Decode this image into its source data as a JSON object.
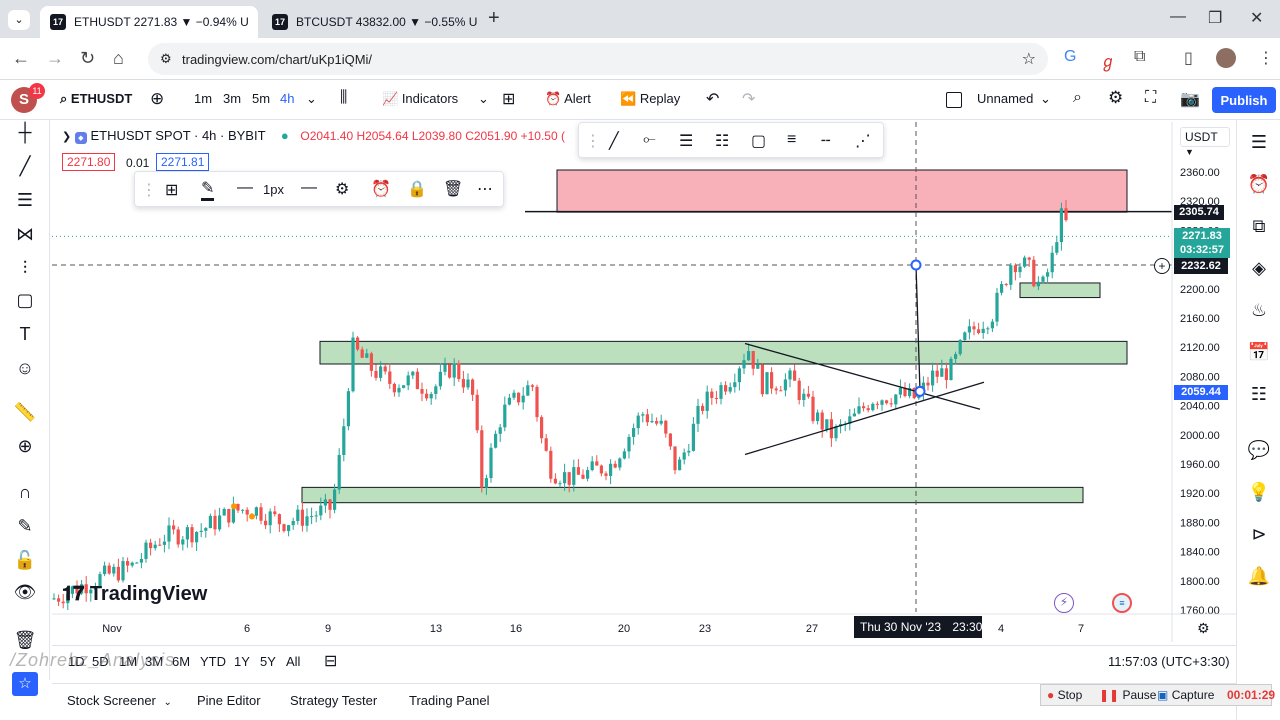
{
  "browser": {
    "tabs": [
      {
        "title": "ETHUSDT 2271.83 ▼ −0.94% U",
        "active": true
      },
      {
        "title": "BTCUSDT 43832.00 ▼ −0.55% U",
        "active": false
      }
    ],
    "new_tab": "+",
    "url": "tradingview.com/chart/uKp1iQMi/"
  },
  "toolbar": {
    "avatar_letter": "S",
    "notifications": "11",
    "symbol": "ETHUSDT",
    "intervals": [
      "1m",
      "3m",
      "5m",
      "4h"
    ],
    "indicators": "Indicators",
    "alert": "Alert",
    "replay": "Replay",
    "layout_name": "Unnamed",
    "publish": "Publish"
  },
  "chart": {
    "title": "ETHUSDT SPOT · 4h · BYBIT",
    "ohlc": "O2041.40 H2054.64 L2039.80 C2051.90 +10.50 (",
    "bid": "2271.80",
    "spread": "0.01",
    "ask": "2271.81",
    "currency": "USDT",
    "watermark": "TradingView",
    "price_ticks": [
      "2360.00",
      "2320.00",
      "2280.00",
      "2240.00",
      "2200.00",
      "2160.00",
      "2120.00",
      "2080.00",
      "2040.00",
      "2000.00",
      "1960.00",
      "1920.00",
      "1880.00",
      "1840.00",
      "1800.00",
      "1760.00"
    ],
    "price_labels": {
      "resistance": "2305.74",
      "last": "2271.83",
      "countdown": "03:32:57",
      "crosshair": "2232.62",
      "blue": "2059.44"
    },
    "time_ticks": [
      "Nov",
      "6",
      "9",
      "13",
      "16",
      "20",
      "23",
      "27",
      "4",
      "7"
    ],
    "crosshair_time": "Thu 30 Nov '23",
    "crosshair_clock": "23:30",
    "drawing_toolbar": {
      "width_label": "1px"
    }
  },
  "bottom": {
    "ranges": [
      "1D",
      "5D",
      "1M",
      "3M",
      "6M",
      "YTD",
      "1Y",
      "5Y",
      "All"
    ],
    "clock": "11:57:03 (UTC+3:30)",
    "channel_watermark": "/Zohrehz_Analysis"
  },
  "panels": [
    "Stock Screener",
    "Pine Editor",
    "Strategy Tester",
    "Trading Panel"
  ],
  "recorder": {
    "stop": "Stop",
    "pause": "Pause",
    "capture": "Capture",
    "elapsed": "00:01:29"
  },
  "colors": {
    "up": "#26a69a",
    "down": "#ef5350",
    "accent": "#2962ff",
    "zone_green": "#a5d6a7",
    "zone_red": "#f7a3ad"
  }
}
